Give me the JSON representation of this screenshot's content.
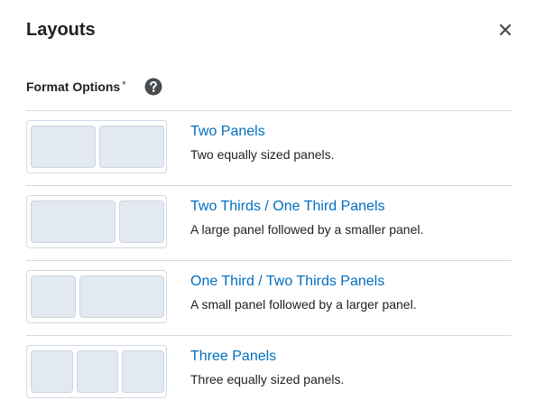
{
  "dialog": {
    "title": "Layouts",
    "close_icon": "close-icon"
  },
  "format": {
    "label": "Format Options",
    "required_mark": "*",
    "help_icon": "question-circle-icon"
  },
  "options": [
    {
      "title": "Two Panels",
      "description": "Two equally sized panels."
    },
    {
      "title": "Two Thirds / One Third Panels",
      "description": "A large panel followed by a smaller panel."
    },
    {
      "title": "One Third / Two Thirds Panels",
      "description": "A small panel followed by a larger panel."
    },
    {
      "title": "Three Panels",
      "description": "Three equally sized panels."
    }
  ],
  "colors": {
    "link": "#006fbf",
    "panel_fill": "#e3e9f1",
    "divider": "#d3d9e3"
  }
}
